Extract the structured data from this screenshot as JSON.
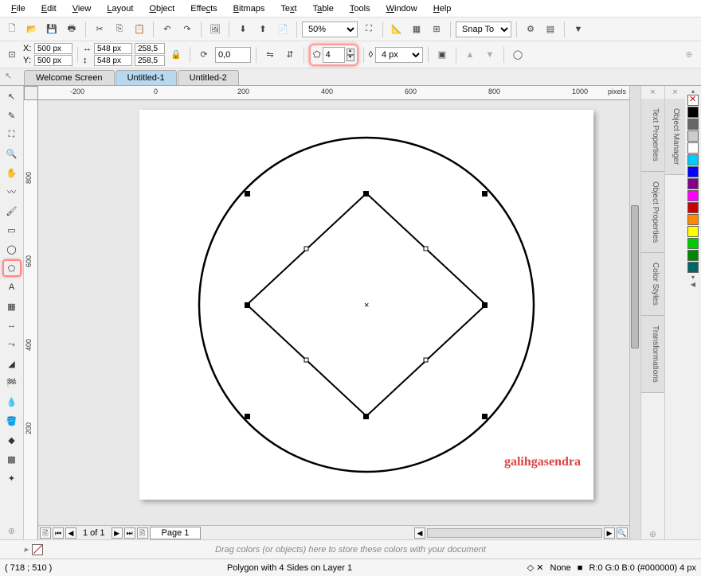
{
  "menu": {
    "file": "File",
    "edit": "Edit",
    "view": "View",
    "layout": "Layout",
    "object": "Object",
    "effects": "Effects",
    "bitmaps": "Bitmaps",
    "text": "Text",
    "table": "Table",
    "tools": "Tools",
    "window": "Window",
    "help": "Help"
  },
  "toolbar1": {
    "zoom": "50%",
    "snap": "Snap To"
  },
  "toolbar2": {
    "x_label": "X:",
    "x_val": "500 px",
    "y_label": "Y:",
    "y_val": "500 px",
    "w_val": "548 px",
    "h_val": "548 px",
    "sx": "258,5",
    "sy": "258,5",
    "rot": "0,0",
    "sides": "4",
    "outline": "4 px"
  },
  "tabs": {
    "t1": "Welcome Screen",
    "t2": "Untitled-1",
    "t3": "Untitled-2"
  },
  "ruler": {
    "h": [
      "-200",
      "0",
      "200",
      "400",
      "600",
      "800",
      "1000"
    ],
    "unit": "pixels",
    "v": [
      "800",
      "600",
      "400",
      "200"
    ]
  },
  "watermark": "galihgasendra",
  "pagebar": {
    "count": "1 of 1",
    "page": "Page 1"
  },
  "dock": {
    "tp": "Text Properties",
    "op": "Object Properties",
    "cs": "Color Styles",
    "tr": "Transformations",
    "om": "Object Manager"
  },
  "hint": "Drag colors (or objects) here to store these colors with your document",
  "status": {
    "cursor": "( 718  ; 510 )",
    "obj": "Polygon with 4 Sides on Layer 1",
    "fill": "None",
    "outline": "R:0 G:0 B:0 (#000000)  4 px"
  },
  "palette": [
    "#000",
    "#666",
    "#ccc",
    "#fff",
    "#0cf",
    "#00f",
    "#808",
    "#f0f",
    "#c00",
    "#f80",
    "#ff0",
    "#0c0",
    "#080",
    "#066"
  ]
}
